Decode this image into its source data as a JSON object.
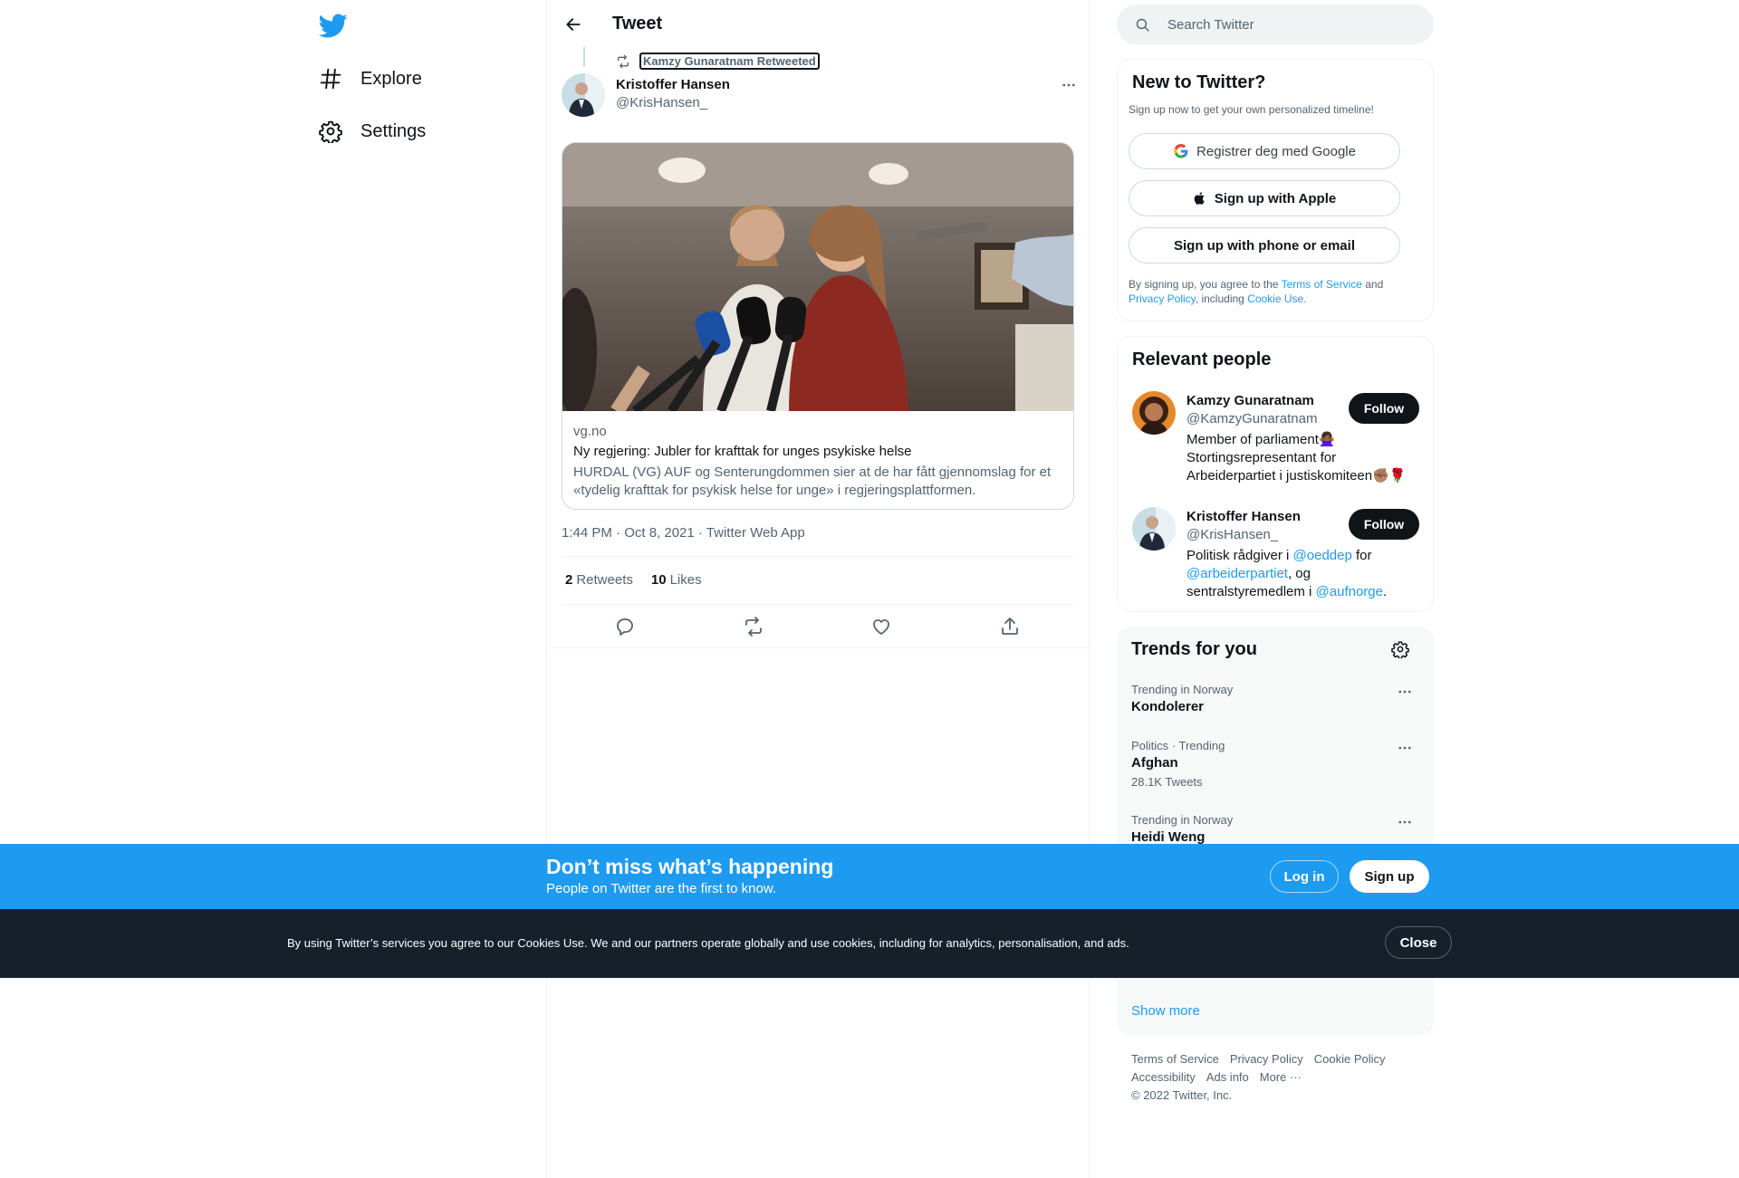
{
  "nav": {
    "explore": "Explore",
    "settings": "Settings"
  },
  "header": {
    "title": "Tweet"
  },
  "tweet": {
    "retweeted_by": "Kamzy Gunaratnam Retweeted",
    "author_name": "Kristoffer Hansen",
    "author_handle": "@KrisHansen_",
    "card": {
      "domain": "vg.no",
      "title": "Ny regjering: Jubler for krafttak for unges psykiske helse",
      "description": "HURDAL (VG) AUF og Senterungdommen sier at de har fått gjennomslag for et «tydelig krafttak for psykisk helse for unge» i regjeringsplattformen."
    },
    "timestamp": "1:44 PM · Oct 8, 2021 · Twitter Web App",
    "retweets_count": "2",
    "retweets_label": "Retweets",
    "likes_count": "10",
    "likes_label": "Likes"
  },
  "search": {
    "placeholder": "Search Twitter"
  },
  "signup": {
    "title": "New to Twitter?",
    "subtitle": "Sign up now to get your own personalized timeline!",
    "google": "Registrer deg med Google",
    "apple": "Sign up with Apple",
    "phone": "Sign up with phone or email",
    "legal_prefix": "By signing up, you agree to the ",
    "terms": "Terms of Service",
    "and": " and",
    "privacy": "Privacy Policy",
    "including": ", including ",
    "cookie": "Cookie Use."
  },
  "relevant": {
    "title": "Relevant people",
    "follow_label": "Follow",
    "people": [
      {
        "name": "Kamzy Gunaratnam",
        "handle": "@KamzyGunaratnam",
        "bio_line1": "Member of parliament🙅🏾‍♀️",
        "bio_line2": "Stortingsrepresentant for",
        "bio_line3": "Arbeiderpartiet i justiskomiteen✊🏽🌹"
      },
      {
        "name": "Kristoffer Hansen",
        "handle": "@KrisHansen_",
        "bio_prefix": "Politisk rådgiver i ",
        "bio_link1": "@oeddep",
        "bio_mid1": " for",
        "bio_link2": "@arbeiderpartiet",
        "bio_mid2": ", og",
        "bio_mid3": "sentralstyremedlem i ",
        "bio_link3": "@aufnorge",
        "bio_end": "."
      }
    ]
  },
  "trends": {
    "title": "Trends for you",
    "items": [
      {
        "context": "Trending in Norway",
        "name": "Kondolerer",
        "count": ""
      },
      {
        "context": "Politics · Trending",
        "name": "Afghan",
        "count": "28.1K Tweets"
      },
      {
        "context": "Trending in Norway",
        "name": "Heidi Weng",
        "count": ""
      }
    ],
    "show_more": "Show more"
  },
  "footer": {
    "row1": [
      "Terms of Service",
      "Privacy Policy",
      "Cookie Policy"
    ],
    "row2": [
      "Accessibility",
      "Ads info",
      "More ···"
    ],
    "copyright": "© 2022 Twitter, Inc."
  },
  "banner": {
    "title": "Don’t miss what’s happening",
    "subtitle": "People on Twitter are the first to know.",
    "login": "Log in",
    "signup": "Sign up"
  },
  "cookie_bar": {
    "text": "By using Twitter’s services you agree to our Cookies Use. We and our partners operate globally and use cookies, including for analytics, personalisation, and ads.",
    "close": "Close"
  },
  "colors": {
    "brand_blue": "#1d9bf0",
    "text_primary": "#0f1419",
    "text_secondary": "#536471",
    "cookie_bg": "#15202b"
  }
}
